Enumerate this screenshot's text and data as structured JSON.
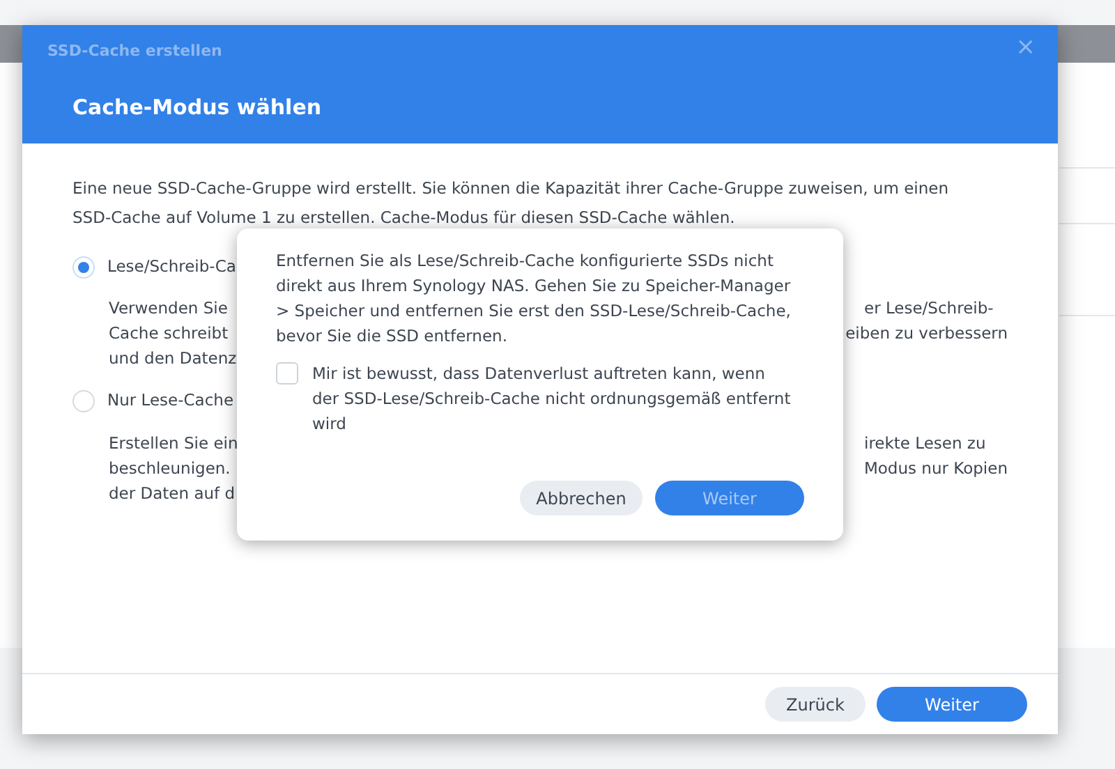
{
  "window": {
    "title": "SSD-Cache erstellen",
    "close": "×"
  },
  "step_title": "Cache-Modus wählen",
  "intro": [
    "Eine neue SSD-Cache-Gruppe wird erstellt. Sie können die Kapazität ihrer Cache-Gruppe zuweisen, um einen",
    "SSD-Cache auf Volume 1 zu erstellen. Cache-Modus für diesen SSD-Cache wählen."
  ],
  "options": [
    {
      "label": "Lese/Schreib-Ca",
      "selected": true,
      "description": [
        {
          "left": "Verwenden Sie",
          "right": "er Lese/Schreib-"
        },
        {
          "left": "Cache schreibt",
          "right": "eiben zu verbessern"
        },
        {
          "left": "und den Datenz"
        }
      ]
    },
    {
      "label": "Nur Lese-Cache",
      "selected": false,
      "description": [
        {
          "left": "Erstellen Sie ein",
          "right": "irekte Lesen zu"
        },
        {
          "left": "beschleunigen.",
          "right": "Modus nur Kopien"
        },
        {
          "left": "der Daten auf d"
        }
      ]
    }
  ],
  "footer_buttons": [
    {
      "label": "Zurück",
      "kind": "secondary"
    },
    {
      "label": "Weiter",
      "kind": "primary"
    }
  ],
  "confirm": {
    "message": "Entfernen Sie als Lese/Schreib-Cache konfigurierte SSDs nicht direkt aus Ihrem Synology NAS. Gehen Sie zu Speicher-Manager > Speicher und entfernen Sie erst den SSD-Lese/Schreib-Cache, bevor Sie die SSD entfernen.",
    "checkbox": {
      "label": "Mir ist bewusst, dass Datenverlust auftreten kann, wenn der SSD-Lese/Schreib-Cache nicht ordnungsgemäß entfernt wird",
      "checked": false
    },
    "buttons": [
      {
        "label": "Abbrechen",
        "kind": "secondary",
        "disabled": false
      },
      {
        "label": "Weiter",
        "kind": "primary",
        "disabled": true
      }
    ]
  }
}
